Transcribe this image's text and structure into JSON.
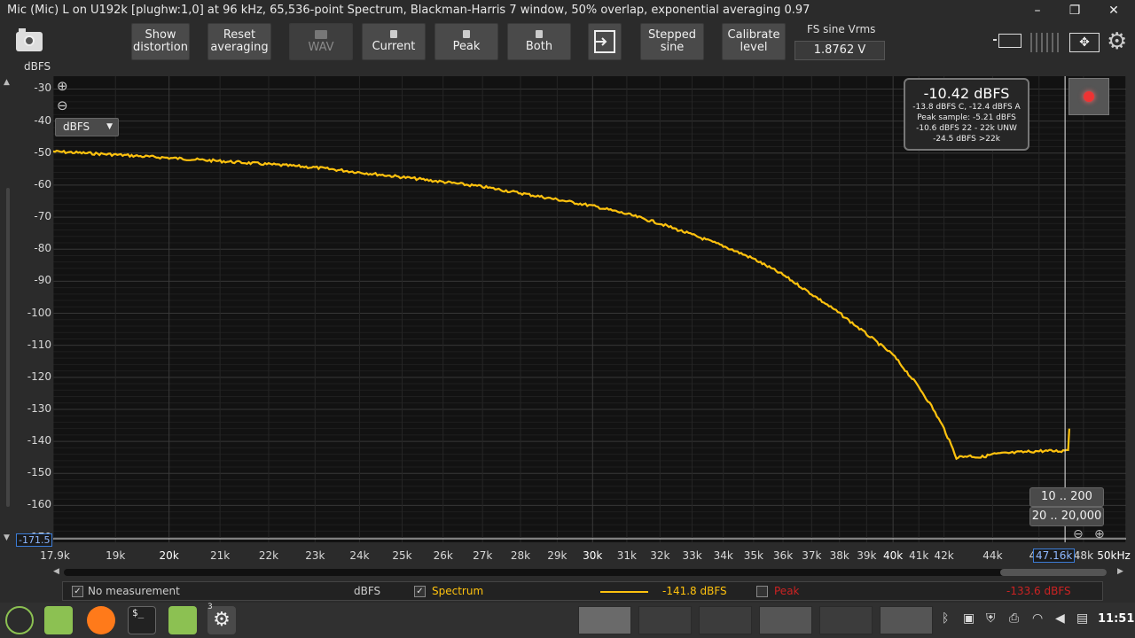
{
  "window": {
    "title": "Mic (Mic) L on U192k [plughw:1,0] at 96 kHz, 65,536-point Spectrum, Blackman-Harris 7 window, 50% overlap, exponential averaging 0.97",
    "minimize_glyph": "–",
    "maximize_glyph": "❐",
    "close_glyph": "✕"
  },
  "toolbar": {
    "show_distortion_l1": "Show",
    "show_distortion_l2": "distortion",
    "reset_averaging_l1": "Reset",
    "reset_averaging_l2": "averaging",
    "wav": "WAV",
    "current": "Current",
    "peak": "Peak",
    "both": "Both",
    "stepped_sine_l1": "Stepped",
    "stepped_sine_l2": "sine",
    "calibrate_l1": "Calibrate",
    "calibrate_l2": "level",
    "fs_sine_label": "FS sine Vrms",
    "fs_sine_value": "1.8762 V",
    "y_unit_label": "dBFS"
  },
  "plot": {
    "unit_dropdown": "dBFS",
    "cursor_readout": "-171.5",
    "cursor_freq": "47.16k",
    "range_btn_1": "10 .. 200",
    "range_btn_2": "20 .. 20,000",
    "zoom_in_glyph": "⊕",
    "zoom_out_glyph": "⊖",
    "level_box": {
      "main": "-10.42 dBFS",
      "line1": "-13.8 dBFS C, -12.4 dBFS A",
      "line2": "Peak sample: -5.21 dBFS",
      "line3": "-10.6 dBFS 22 - 22k UNW",
      "line4": "-24.5 dBFS >22k"
    }
  },
  "status": {
    "no_measurement": "No measurement",
    "unit": "dBFS",
    "spectrum": "Spectrum",
    "spectrum_value": "-141.8 dBFS",
    "peak": "Peak",
    "peak_value": "-133.6 dBFS",
    "check_glyph": "✓"
  },
  "taskbar": {
    "clock": "11:51",
    "badge": "3",
    "terminal_glyph": "$_"
  },
  "colors": {
    "trace": "#ffc20e",
    "peak": "#cc2222",
    "grid": "#2c2c2c"
  },
  "chart_data": {
    "type": "line",
    "title": "",
    "xlabel": "",
    "ylabel": "dBFS",
    "xlim": [
      17900,
      50000
    ],
    "ylim": [
      -171.5,
      -26
    ],
    "x_scale": "log",
    "y_ticks": [
      -30,
      -40,
      -50,
      -60,
      -70,
      -80,
      -90,
      -100,
      -110,
      -120,
      -130,
      -140,
      -150,
      -160,
      -170
    ],
    "x_tick_labels": [
      "17.9k",
      "19k",
      "20k",
      "21k",
      "22k",
      "23k",
      "24k",
      "25k",
      "26k",
      "27k",
      "28k",
      "29k",
      "30k",
      "31k",
      "32k",
      "33k",
      "34k",
      "35k",
      "36k",
      "37k",
      "38k",
      "39k",
      "40k",
      "41k",
      "42k",
      "44k",
      "46k",
      "48k",
      "50kHz"
    ],
    "x_ticks": [
      17900,
      19000,
      20000,
      21000,
      22000,
      23000,
      24000,
      25000,
      26000,
      27000,
      28000,
      29000,
      30000,
      31000,
      32000,
      33000,
      34000,
      35000,
      36000,
      37000,
      38000,
      39000,
      40000,
      41000,
      42000,
      44000,
      46000,
      48000,
      50000
    ],
    "series": [
      {
        "name": "Spectrum",
        "x": [
          17900,
          19000,
          20000,
          21000,
          22000,
          23000,
          24000,
          25000,
          26000,
          27000,
          28000,
          29000,
          30000,
          31000,
          32000,
          33000,
          34000,
          35000,
          36000,
          37000,
          38000,
          39000,
          40000,
          41000,
          41500,
          42000,
          42500,
          43000,
          43500,
          44000,
          45000,
          46000,
          47000,
          47300,
          47350
        ],
        "y": [
          -49.5,
          -50.5,
          -51.5,
          -52.5,
          -53.5,
          -54.5,
          -56,
          -57.5,
          -59,
          -60.5,
          -62.5,
          -64.5,
          -66.5,
          -69,
          -72,
          -75.5,
          -79,
          -83,
          -88,
          -94,
          -100,
          -106.5,
          -113,
          -123,
          -129,
          -136,
          -145,
          -144.5,
          -145,
          -144,
          -143.5,
          -143,
          -143,
          -142.5,
          -136
        ]
      }
    ],
    "cursor_x": 47160
  }
}
